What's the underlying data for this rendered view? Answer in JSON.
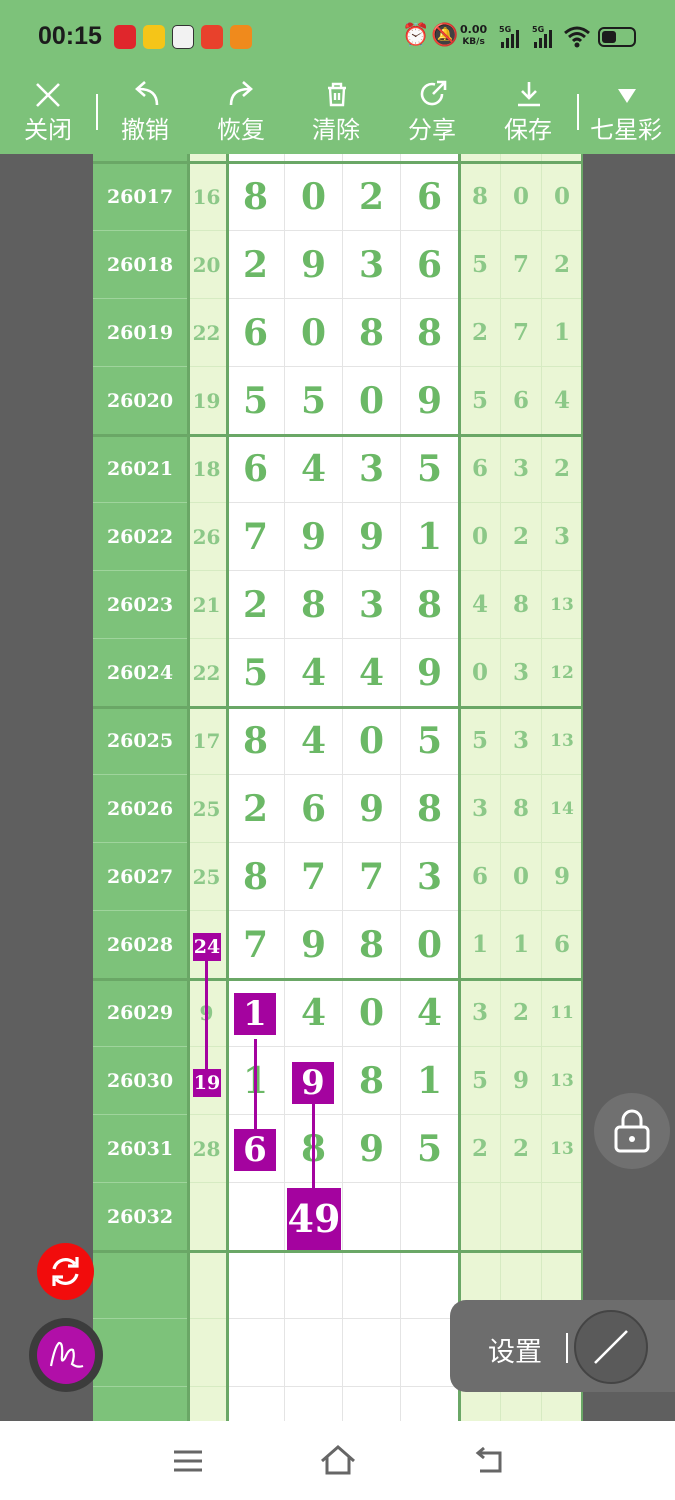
{
  "status_bar": {
    "time": "00:15",
    "net_speed_value": "0.00",
    "net_speed_unit": "KB/s",
    "sim1": "5G",
    "sim2": "5G",
    "battery_level": 0.45
  },
  "toolbar": {
    "close": "关闭",
    "undo": "撤销",
    "redo": "恢复",
    "clear": "清除",
    "share": "分享",
    "save": "保存",
    "lottery": "七星彩"
  },
  "rows": [
    {
      "id": "26017",
      "sum": "16",
      "d": [
        "8",
        "0",
        "2",
        "6"
      ],
      "s": [
        "8",
        "0",
        "0"
      ]
    },
    {
      "id": "26018",
      "sum": "20",
      "d": [
        "2",
        "9",
        "3",
        "6"
      ],
      "s": [
        "5",
        "7",
        "2"
      ]
    },
    {
      "id": "26019",
      "sum": "22",
      "d": [
        "6",
        "0",
        "8",
        "8"
      ],
      "s": [
        "2",
        "7",
        "1"
      ]
    },
    {
      "id": "26020",
      "sum": "19",
      "d": [
        "5",
        "5",
        "0",
        "9"
      ],
      "s": [
        "5",
        "6",
        "4"
      ]
    },
    {
      "id": "26021",
      "sum": "18",
      "d": [
        "6",
        "4",
        "3",
        "5"
      ],
      "s": [
        "6",
        "3",
        "2"
      ]
    },
    {
      "id": "26022",
      "sum": "26",
      "d": [
        "7",
        "9",
        "9",
        "1"
      ],
      "s": [
        "0",
        "2",
        "3"
      ]
    },
    {
      "id": "26023",
      "sum": "21",
      "d": [
        "2",
        "8",
        "3",
        "8"
      ],
      "s": [
        "4",
        "8",
        "13"
      ]
    },
    {
      "id": "26024",
      "sum": "22",
      "d": [
        "5",
        "4",
        "4",
        "9"
      ],
      "s": [
        "0",
        "3",
        "12"
      ]
    },
    {
      "id": "26025",
      "sum": "17",
      "d": [
        "8",
        "4",
        "0",
        "5"
      ],
      "s": [
        "5",
        "3",
        "13"
      ]
    },
    {
      "id": "26026",
      "sum": "25",
      "d": [
        "2",
        "6",
        "9",
        "8"
      ],
      "s": [
        "3",
        "8",
        "14"
      ]
    },
    {
      "id": "26027",
      "sum": "25",
      "d": [
        "8",
        "7",
        "7",
        "3"
      ],
      "s": [
        "6",
        "0",
        "9"
      ]
    },
    {
      "id": "26028",
      "sum": "24",
      "d": [
        "7",
        "9",
        "8",
        "0"
      ],
      "s": [
        "1",
        "1",
        "6"
      ]
    },
    {
      "id": "26029",
      "sum": "9",
      "d": [
        "1",
        "4",
        "0",
        "4"
      ],
      "s": [
        "3",
        "2",
        "11"
      ]
    },
    {
      "id": "26030",
      "sum": "19",
      "d": [
        "1",
        "9",
        "8",
        "1"
      ],
      "s": [
        "5",
        "9",
        "13"
      ]
    },
    {
      "id": "26031",
      "sum": "28",
      "d": [
        "6",
        "8",
        "9",
        "5"
      ],
      "s": [
        "2",
        "2",
        "13"
      ]
    },
    {
      "id": "26032",
      "sum": "",
      "d": [
        "",
        "",
        "",
        ""
      ],
      "s": [
        "",
        "",
        ""
      ]
    },
    {
      "id": "",
      "sum": "",
      "d": [
        "",
        "",
        "",
        ""
      ],
      "s": [
        "",
        "",
        ""
      ]
    },
    {
      "id": "",
      "sum": "",
      "d": [
        "",
        "",
        "",
        ""
      ],
      "s": [
        "",
        "",
        ""
      ]
    },
    {
      "id": "",
      "sum": "",
      "d": [
        "",
        "",
        "",
        ""
      ],
      "s": [
        "",
        "",
        ""
      ]
    }
  ],
  "marks": {
    "sum_26028": "24",
    "sum_26030": "19",
    "d1_26029": "1",
    "d1_26031": "6",
    "d2_26030": "9",
    "d2_26032": "49"
  },
  "settings_panel": {
    "label": "设置"
  },
  "colors": {
    "accent_green": "#7dc27a",
    "digit_green": "#6bb866",
    "mark_purple": "#a4039f",
    "refresh_red": "#f20c0c"
  }
}
